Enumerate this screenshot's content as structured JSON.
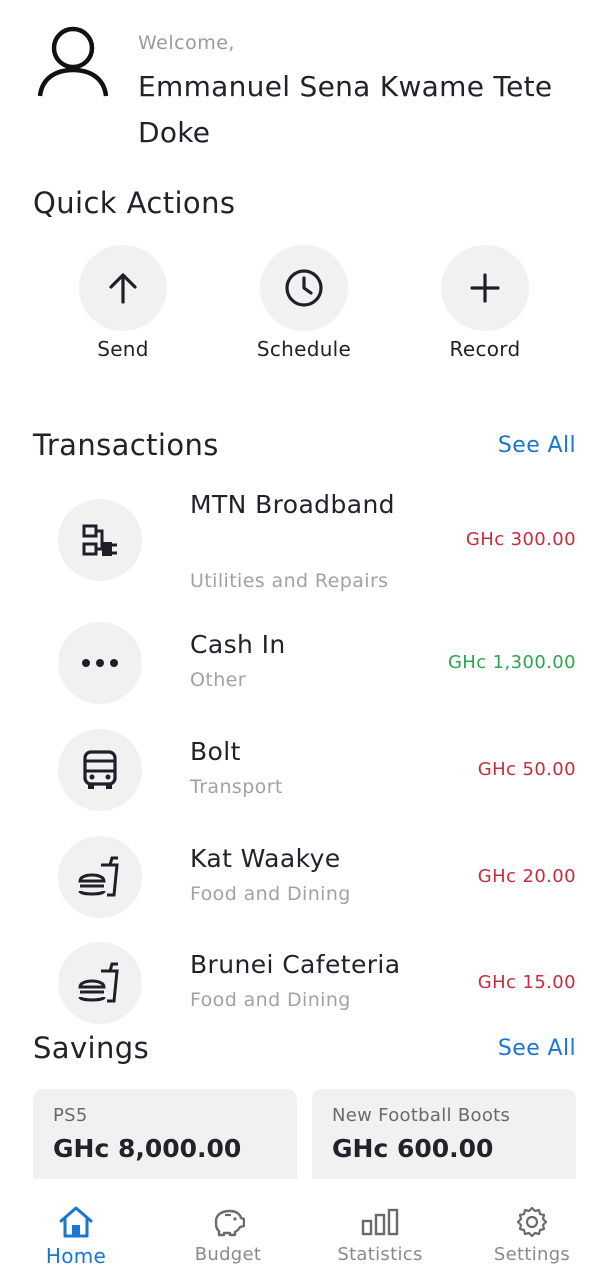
{
  "header": {
    "welcome": "Welcome,",
    "user_name": "Emmanuel Sena Kwame Tete Doke",
    "avatar_icon": "user-icon"
  },
  "quick_actions": {
    "title": "Quick Actions",
    "items": [
      {
        "label": "Send",
        "icon": "arrow-up-icon"
      },
      {
        "label": "Schedule",
        "icon": "clock-icon"
      },
      {
        "label": "Record",
        "icon": "plus-icon"
      }
    ]
  },
  "transactions": {
    "title": "Transactions",
    "see_all": "See All",
    "items": [
      {
        "name": "MTN Broadband",
        "category": "Utilities and Repairs",
        "amount": "GHc 300.00",
        "type": "expense",
        "icon": "plug-icon"
      },
      {
        "name": "Cash In",
        "category": "Other",
        "amount": "GHc 1,300.00",
        "type": "income",
        "icon": "more-dots-icon"
      },
      {
        "name": "Bolt",
        "category": "Transport",
        "amount": "GHc 50.00",
        "type": "expense",
        "icon": "bus-icon"
      },
      {
        "name": "Kat Waakye",
        "category": "Food and Dining",
        "amount": "GHc 20.00",
        "type": "expense",
        "icon": "fastfood-icon"
      },
      {
        "name": "Brunei Cafeteria",
        "category": "Food and Dining",
        "amount": "GHc 15.00",
        "type": "expense",
        "icon": "fastfood-icon"
      }
    ]
  },
  "savings": {
    "title": "Savings",
    "see_all": "See All",
    "items": [
      {
        "name": "PS5",
        "amount": "GHc 8,000.00"
      },
      {
        "name": "New Football Boots",
        "amount": "GHc 600.00"
      }
    ]
  },
  "nav": {
    "items": [
      {
        "label": "Home",
        "icon": "home-icon",
        "active": true
      },
      {
        "label": "Budget",
        "icon": "piggy-bank-icon",
        "active": false
      },
      {
        "label": "Statistics",
        "icon": "bar-chart-icon",
        "active": false
      },
      {
        "label": "Settings",
        "icon": "gear-icon",
        "active": false
      }
    ]
  },
  "colors": {
    "accent": "#1976d2",
    "expense": "#c62d3e",
    "income": "#2ea44f",
    "surface": "#f1f1f2"
  }
}
